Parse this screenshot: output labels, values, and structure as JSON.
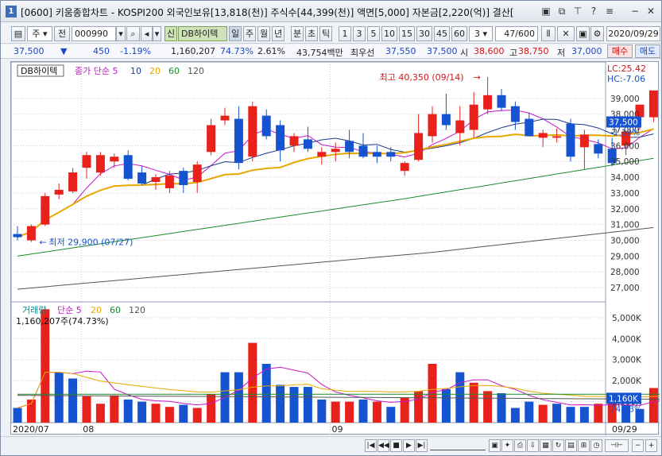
{
  "title_bar": {
    "app_number": "1",
    "title": "[0600] 키움종합차트 - KOSPI200 외국인보유[13,818(천)] 주식수[44,399(천)] 액면[5,000] 자본금[2,220(억)] 결산["
  },
  "toolbar": {
    "type_select": "주",
    "prev_label": "전",
    "code_value": "000990",
    "market_tag": "신",
    "stock_name": "DB하이텍",
    "periods": [
      "일",
      "주",
      "월",
      "년",
      "분",
      "초",
      "틱"
    ],
    "minutes": [
      "1",
      "3",
      "5",
      "10",
      "15",
      "30",
      "45",
      "60"
    ],
    "minute_select": "3",
    "page_counter": "47/600",
    "date_value": "2020/09/29"
  },
  "info_bar": {
    "price": "37,500",
    "arrow": "▼",
    "change": "450",
    "change_rate": "-1.19%",
    "volume": "1,160,207",
    "volume_rate": "74.73%",
    "turnover": "2.61%",
    "amount": "43,754백만",
    "best_ask_label": "최우선",
    "best_ask": "37,550",
    "best_bid": "37,500",
    "open_label": "시",
    "open": "38,600",
    "high_label": "고",
    "high": "38,750",
    "low_label": "저",
    "low": "37,000",
    "buy_button": "매수",
    "sell_button": "매도"
  },
  "chart_data": [
    {
      "type": "candlestick",
      "title": "DB하이텍",
      "legend": [
        {
          "name": "종가 단순 5",
          "color": "#c815c8"
        },
        {
          "name": "10",
          "color": "#1a3a8c"
        },
        {
          "name": "20",
          "color": "#e8a800"
        },
        {
          "name": "60",
          "color": "#1a8c2a"
        },
        {
          "name": "120",
          "color": "#555555"
        }
      ],
      "ylim": [
        26300,
        40800
      ],
      "y_ticks": [
        27000,
        28000,
        29000,
        30000,
        31000,
        32000,
        33000,
        34000,
        35000,
        36000,
        37000,
        38000,
        39000
      ],
      "annotations": {
        "high_text": "최고 40,350 (09/14)",
        "low_text": "최저 29,900 (07/27)",
        "lc_text": "LC:25.42",
        "hc_text": "HC:-7.06",
        "last_price": "37,500",
        "last_change": "-1.19%"
      },
      "x_labels": [
        "2020/07",
        "08",
        "09",
        "09/29"
      ],
      "candles": [
        {
          "o": 30400,
          "h": 30900,
          "l": 30000,
          "c": 30200
        },
        {
          "o": 30000,
          "h": 31000,
          "l": 29900,
          "c": 30900
        },
        {
          "o": 31000,
          "h": 33000,
          "l": 30900,
          "c": 32800
        },
        {
          "o": 32900,
          "h": 33600,
          "l": 32600,
          "c": 33200
        },
        {
          "o": 33100,
          "h": 34600,
          "l": 33000,
          "c": 34300
        },
        {
          "o": 34600,
          "h": 35600,
          "l": 33900,
          "c": 35400
        },
        {
          "o": 34300,
          "h": 35600,
          "l": 34100,
          "c": 35400
        },
        {
          "o": 35000,
          "h": 35500,
          "l": 34600,
          "c": 35300
        },
        {
          "o": 35400,
          "h": 35700,
          "l": 33800,
          "c": 33900
        },
        {
          "o": 34300,
          "h": 34700,
          "l": 33500,
          "c": 33600
        },
        {
          "o": 33700,
          "h": 34200,
          "l": 33200,
          "c": 34000
        },
        {
          "o": 33300,
          "h": 34400,
          "l": 33000,
          "c": 34100
        },
        {
          "o": 34400,
          "h": 34600,
          "l": 33000,
          "c": 33500
        },
        {
          "o": 33700,
          "h": 35000,
          "l": 33000,
          "c": 34800
        },
        {
          "o": 35600,
          "h": 37700,
          "l": 35400,
          "c": 37300
        },
        {
          "o": 37600,
          "h": 38400,
          "l": 37300,
          "c": 37900
        },
        {
          "o": 37700,
          "h": 38500,
          "l": 34500,
          "c": 34900
        },
        {
          "o": 35300,
          "h": 38800,
          "l": 35000,
          "c": 38500
        },
        {
          "o": 37900,
          "h": 38300,
          "l": 36400,
          "c": 36600
        },
        {
          "o": 37300,
          "h": 37600,
          "l": 35000,
          "c": 35700
        },
        {
          "o": 36000,
          "h": 36800,
          "l": 35600,
          "c": 36600
        },
        {
          "o": 36400,
          "h": 37200,
          "l": 35600,
          "c": 35800
        },
        {
          "o": 35300,
          "h": 35900,
          "l": 34800,
          "c": 35600
        },
        {
          "o": 35600,
          "h": 36200,
          "l": 35000,
          "c": 35800
        },
        {
          "o": 36300,
          "h": 37000,
          "l": 35200,
          "c": 35600
        },
        {
          "o": 36000,
          "h": 36800,
          "l": 35200,
          "c": 35300
        },
        {
          "o": 35600,
          "h": 36000,
          "l": 34900,
          "c": 35300
        },
        {
          "o": 35600,
          "h": 35900,
          "l": 35000,
          "c": 35300
        },
        {
          "o": 34400,
          "h": 35000,
          "l": 34100,
          "c": 34900
        },
        {
          "o": 35100,
          "h": 38000,
          "l": 35000,
          "c": 36800
        },
        {
          "o": 36600,
          "h": 38500,
          "l": 36200,
          "c": 38000
        },
        {
          "o": 38000,
          "h": 39300,
          "l": 37000,
          "c": 37300
        },
        {
          "o": 36800,
          "h": 38500,
          "l": 36000,
          "c": 37600
        },
        {
          "o": 37000,
          "h": 39400,
          "l": 36500,
          "c": 38600
        },
        {
          "o": 38300,
          "h": 40350,
          "l": 38000,
          "c": 39200
        },
        {
          "o": 39200,
          "h": 39600,
          "l": 38200,
          "c": 38400
        },
        {
          "o": 38500,
          "h": 38800,
          "l": 37000,
          "c": 37500
        },
        {
          "o": 37700,
          "h": 38100,
          "l": 36600,
          "c": 36600
        },
        {
          "o": 36500,
          "h": 37000,
          "l": 35900,
          "c": 36800
        },
        {
          "o": 36500,
          "h": 37100,
          "l": 36200,
          "c": 36600
        },
        {
          "o": 37400,
          "h": 37700,
          "l": 35000,
          "c": 35300
        },
        {
          "o": 35900,
          "h": 37000,
          "l": 34500,
          "c": 36700
        },
        {
          "o": 36100,
          "h": 36400,
          "l": 35200,
          "c": 35500
        },
        {
          "o": 35800,
          "h": 36500,
          "l": 34700,
          "c": 34900
        },
        {
          "o": 36000,
          "h": 37000,
          "l": 35400,
          "c": 36900
        },
        {
          "o": 37800,
          "h": 38600,
          "l": 37000,
          "c": 38600
        },
        {
          "o": 37800,
          "h": 39500,
          "l": 37500,
          "c": 39500
        }
      ]
    },
    {
      "type": "bar",
      "title": "거래량",
      "legend": [
        {
          "name": "단순 5",
          "color": "#c815c8"
        },
        {
          "name": "20",
          "color": "#e8a800"
        },
        {
          "name": "60",
          "color": "#1a8c2a"
        },
        {
          "name": "120",
          "color": "#555555"
        }
      ],
      "current_label": "1,160,207주(74.73%)",
      "ylim": [
        0,
        5600
      ],
      "y_ticks": [
        1000,
        2000,
        3000,
        4000,
        5000
      ],
      "y_tick_suffix": "K",
      "last_volume": "1,160K",
      "last_rate": "74.73%",
      "values_k": [
        700,
        1100,
        5400,
        2400,
        2100,
        1250,
        900,
        1300,
        1100,
        1000,
        900,
        750,
        850,
        700,
        1350,
        2400,
        2400,
        3800,
        2800,
        1800,
        1700,
        1700,
        1100,
        1000,
        1000,
        1100,
        1000,
        750,
        1200,
        1500,
        2800,
        1600,
        2400,
        1900,
        1500,
        1400,
        700,
        1000,
        850,
        900,
        750,
        750,
        900,
        950,
        850,
        650,
        1650,
        1250
      ],
      "up": [
        0,
        1,
        1,
        0,
        0,
        1,
        1,
        1,
        0,
        0,
        1,
        1,
        0,
        1,
        1,
        0,
        0,
        1,
        0,
        0,
        0,
        0,
        0,
        1,
        1,
        0,
        1,
        0,
        1,
        1,
        1,
        0,
        0,
        1,
        1,
        0,
        0,
        0,
        1,
        0,
        0,
        0,
        1,
        1,
        0,
        0,
        1,
        0
      ]
    }
  ],
  "scroll_controls": {
    "zoom_out": "−",
    "zoom_in": "+"
  }
}
